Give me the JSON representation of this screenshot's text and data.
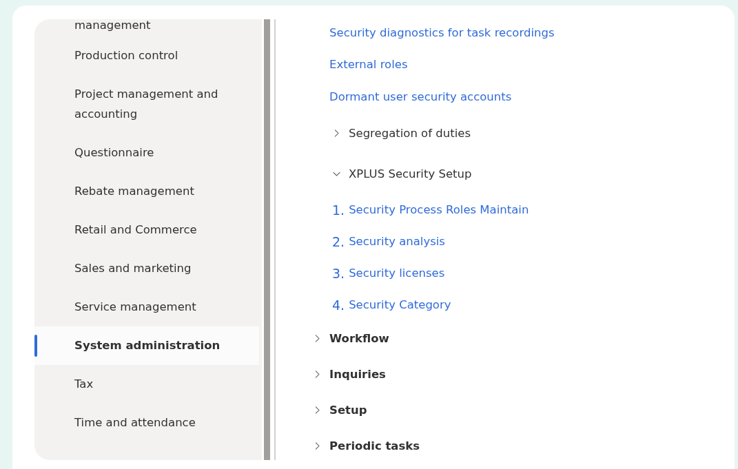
{
  "sidebar": {
    "items": [
      {
        "label": "management",
        "selected": false
      },
      {
        "label": "Production control",
        "selected": false
      },
      {
        "label": "Project management and accounting",
        "selected": false
      },
      {
        "label": "Questionnaire",
        "selected": false
      },
      {
        "label": "Rebate management",
        "selected": false
      },
      {
        "label": "Retail and Commerce",
        "selected": false
      },
      {
        "label": "Sales and marketing",
        "selected": false
      },
      {
        "label": "Service management",
        "selected": false
      },
      {
        "label": "System administration",
        "selected": true
      },
      {
        "label": "Tax",
        "selected": false
      },
      {
        "label": "Time and attendance",
        "selected": false
      }
    ]
  },
  "content": {
    "rows": [
      {
        "kind": "link",
        "label": "Security diagnostics for task recordings"
      },
      {
        "kind": "link",
        "label": "External roles"
      },
      {
        "kind": "link",
        "label": "Dormant user security accounts"
      },
      {
        "kind": "subgroup",
        "label": "Segregation of duties",
        "expanded": false
      },
      {
        "kind": "subgroup",
        "label": "XPLUS Security Setup",
        "expanded": true,
        "children": [
          {
            "number": "1.",
            "label": "Security Process Roles Maintain"
          },
          {
            "number": "2.",
            "label": "Security analysis"
          },
          {
            "number": "3.",
            "label": "Security licenses"
          },
          {
            "number": "4.",
            "label": "Security Category"
          }
        ]
      },
      {
        "kind": "group",
        "label": "Workflow",
        "expanded": false
      },
      {
        "kind": "group",
        "label": "Inquiries",
        "expanded": false
      },
      {
        "kind": "group",
        "label": "Setup",
        "expanded": false
      },
      {
        "kind": "group",
        "label": "Periodic tasks",
        "expanded": false
      }
    ]
  }
}
